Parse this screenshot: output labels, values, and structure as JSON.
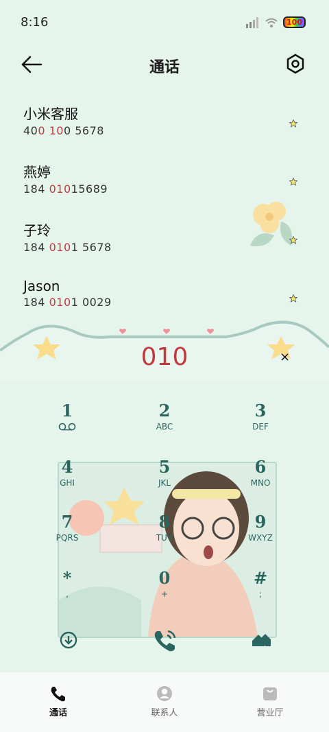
{
  "status": {
    "time": "8:16",
    "battery": "100"
  },
  "header": {
    "title": "通话"
  },
  "contacts": [
    {
      "name": "小米客服",
      "num_pre": "40",
      "num_hl": "0 10",
      "num_post": "0 5678"
    },
    {
      "name": "燕婷",
      "num_pre": "184 ",
      "num_hl": "010",
      "num_post": "15689"
    },
    {
      "name": "子玲",
      "num_pre": "184 ",
      "num_hl": "010",
      "num_post": "1 5678"
    },
    {
      "name": "Jason",
      "num_pre": "184 ",
      "num_hl": "010",
      "num_post": "1 0029"
    }
  ],
  "dial": {
    "digits": "010",
    "clear": "×"
  },
  "keys": [
    {
      "d": "1",
      "l": ""
    },
    {
      "d": "2",
      "l": "ABC"
    },
    {
      "d": "3",
      "l": "DEF"
    },
    {
      "d": "4",
      "l": "GHI"
    },
    {
      "d": "5",
      "l": "JKL"
    },
    {
      "d": "6",
      "l": "MNO"
    },
    {
      "d": "7",
      "l": "PQRS"
    },
    {
      "d": "8",
      "l": "TUV"
    },
    {
      "d": "9",
      "l": "WXYZ"
    },
    {
      "d": "*",
      "l": ","
    },
    {
      "d": "0",
      "l": "+"
    },
    {
      "d": "#",
      "l": ";"
    }
  ],
  "nav": {
    "tab1": "通话",
    "tab2": "联系人",
    "tab3": "营业厅"
  },
  "colors": {
    "accent": "#c0393b",
    "teal": "#2a6560",
    "bg": "#e6f5ec"
  }
}
